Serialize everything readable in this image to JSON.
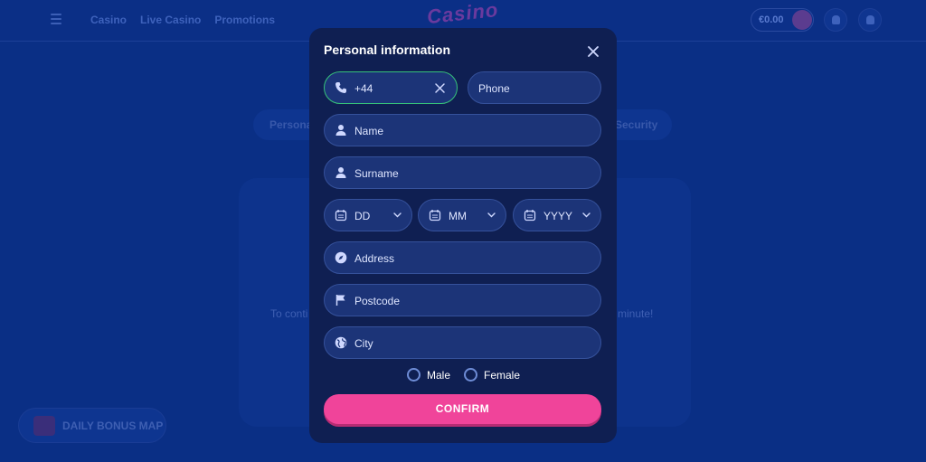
{
  "header": {
    "nav": [
      "Casino",
      "Live Casino",
      "Promotions"
    ],
    "logo": "Casino",
    "balance": "€0.00"
  },
  "background": {
    "tabs": [
      "Persona",
      "Security"
    ],
    "card_text_left": "To conti",
    "card_text_right": "minute!",
    "bonus_label": "DAILY BONUS MAP"
  },
  "modal": {
    "title": "Personal information",
    "phone_code": "+44",
    "phone_placeholder": "Phone",
    "name_placeholder": "Name",
    "surname_placeholder": "Surname",
    "day_placeholder": "DD",
    "month_placeholder": "MM",
    "year_placeholder": "YYYY",
    "address_placeholder": "Address",
    "postcode_placeholder": "Postcode",
    "city_placeholder": "City",
    "gender_options": [
      "Male",
      "Female"
    ],
    "confirm_label": "CONFIRM"
  },
  "colors": {
    "page_bg": "#0a2f85",
    "modal_bg": "#0f1f52",
    "field_bg": "#1c3478",
    "active_border": "#36c27a",
    "confirm": "#f0449a"
  }
}
